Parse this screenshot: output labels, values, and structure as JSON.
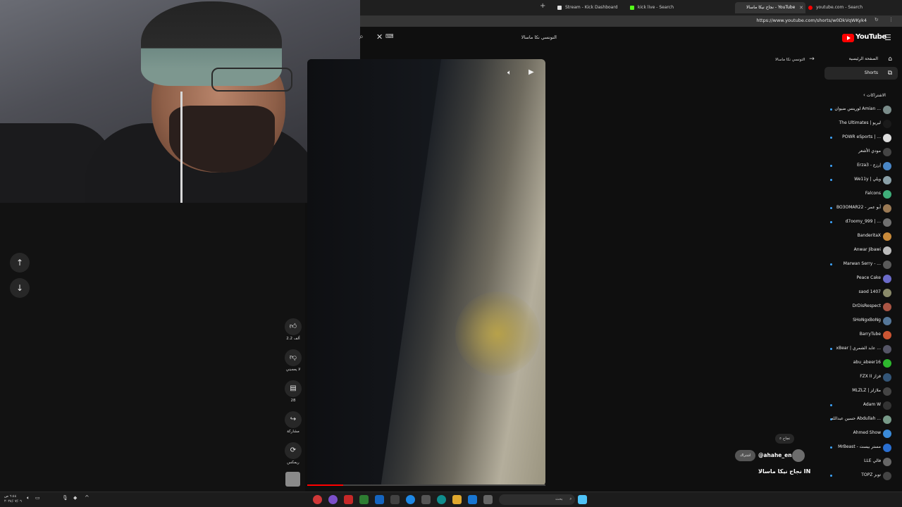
{
  "browser": {
    "tabs": [
      {
        "label": "Stream - Kick Dashboard",
        "color": "#53fc18",
        "active": false
      },
      {
        "label": "kick live - Search",
        "color": "#2b9b3e",
        "active": false
      },
      {
        "label": "نجاح نيكا ماسالا - YouTube",
        "color": "#ff0000",
        "active": true
      },
      {
        "label": "youtube.com - Search",
        "color": "#3b78e7",
        "active": false
      }
    ],
    "url": "https://www.youtube.com/shorts/w0DkVqWKyk4"
  },
  "search": {
    "query": "التونسي نكا ماسالا"
  },
  "youtube": {
    "logo_text": "YouTube",
    "nav": [
      {
        "label": "الصفحة الرئيسية",
        "icon": "home-icon"
      },
      {
        "label": "Shorts",
        "icon": "shorts-icon",
        "active": true
      }
    ],
    "back_link": "التونسي نكا ماسالا",
    "subscriptions_title": "الاشتراكات",
    "subscriptions": [
      {
        "name": "لورينس ضيوان Amian ...",
        "color": "#7a8c8a",
        "dot": true
      },
      {
        "name": "The Ultimates | ليريو",
        "color": "#1a1a1a",
        "dot": false
      },
      {
        "name": "POWR eSports | ...",
        "color": "#dddddd",
        "dot": true
      },
      {
        "name": "مودي الأشعر",
        "color": "#444444",
        "dot": false
      },
      {
        "name": "Erza3 - إرزع",
        "color": "#4a87c7",
        "dot": true
      },
      {
        "name": "We11y | ويلي",
        "color": "#8aa0a8",
        "dot": true
      },
      {
        "name": "Falcons",
        "color": "#3fae7a",
        "dot": false
      },
      {
        "name": "BO3OMAR22 - أبو عمر",
        "color": "#9b7a55",
        "dot": true
      },
      {
        "name": "d7oomy_999 | ...",
        "color": "#707070",
        "dot": true
      },
      {
        "name": "BanderitaX",
        "color": "#c98a3a",
        "dot": false
      },
      {
        "name": "Anwar Jibawi",
        "color": "#bbbbbb",
        "dot": false
      },
      {
        "name": "Marwan Serry - ...",
        "color": "#5a5a5a",
        "dot": true
      },
      {
        "name": "Peace Cake",
        "color": "#6b6bc9",
        "dot": false
      },
      {
        "name": "saod 1407",
        "color": "#8a8a6a",
        "dot": false
      },
      {
        "name": "DrDisRespect",
        "color": "#aa5544",
        "dot": false
      },
      {
        "name": "SHoNgxBoNg",
        "color": "#557799",
        "dot": false
      },
      {
        "name": "BarryTube",
        "color": "#cc5533",
        "dot": false
      },
      {
        "name": "xBear | عابد الشمري ...",
        "color": "#555566",
        "dot": true
      },
      {
        "name": "abu_abeer16",
        "color": "#2eb82e",
        "dot": false
      },
      {
        "name": "FZX II فزاز",
        "color": "#335577",
        "dot": false
      },
      {
        "name": "MLZLZ | ملازلز",
        "color": "#444444",
        "dot": false
      },
      {
        "name": "Adam W",
        "color": "#333333",
        "dot": true
      },
      {
        "name": "حسين عبدالله Abdullah ...",
        "color": "#779988",
        "dot": true
      },
      {
        "name": "Ahmed Show",
        "color": "#3b8bd9",
        "dot": false
      },
      {
        "name": "MrBeast - مستر بيست",
        "color": "#2a6fd1",
        "dot": true
      },
      {
        "name": "LLE فالي",
        "color": "#666666",
        "dot": false
      },
      {
        "name": "TOPZ توبز",
        "color": "#444444",
        "dot": true
      }
    ]
  },
  "short": {
    "likes": "2.2 ألف",
    "dislike_label": "لا يعجبني",
    "comments": "28",
    "share_label": "مشاركة",
    "remix_label": "ريمكس",
    "tag": "نجاح",
    "channel": "@ahahe_en",
    "subscribe_label": "اشتراك",
    "title": "نجاح نيكا ماسالا IN",
    "progress": 0.15
  },
  "taskbar": {
    "search_placeholder": "بحث",
    "time": "٦:٤٤ ص",
    "date": "٢٠٢٤/٠٧/٠٦"
  }
}
